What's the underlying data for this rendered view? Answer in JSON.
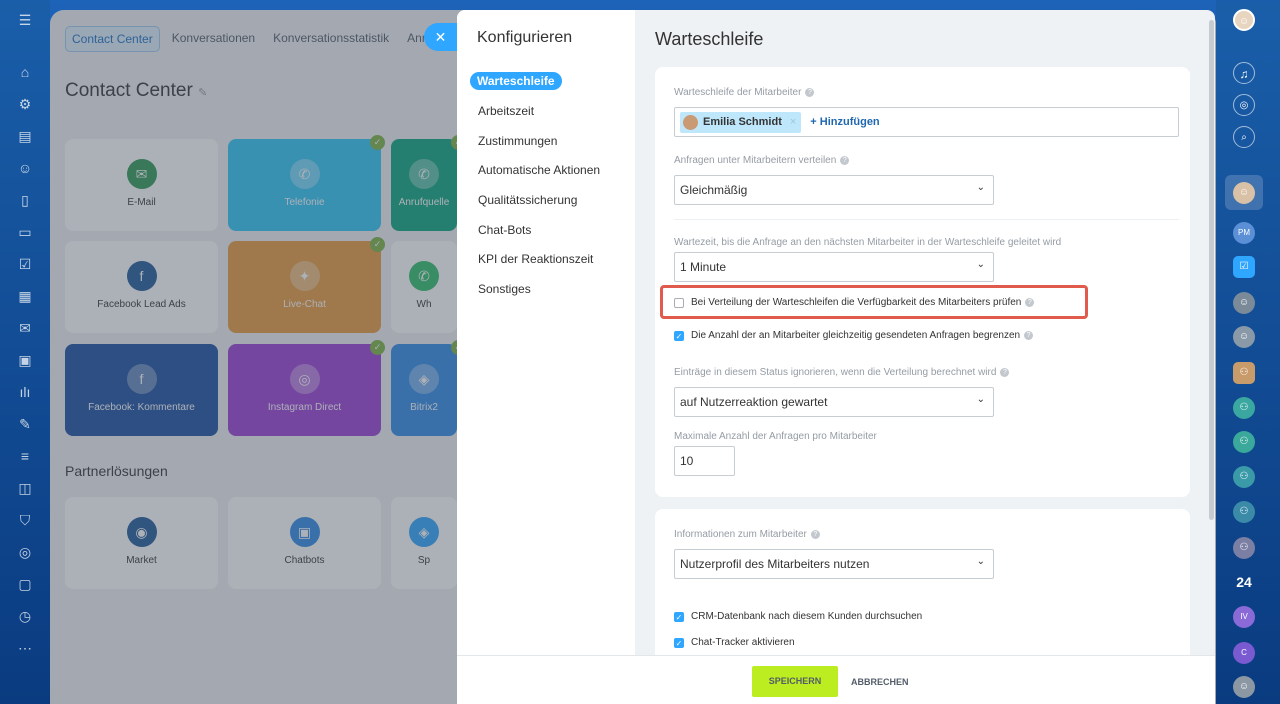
{
  "background": {
    "tabs": [
      "Contact Center",
      "Konversationen",
      "Konversationsstatistik",
      "Anrufu"
    ],
    "title": "Contact Center",
    "tiles": [
      {
        "label": "E-Mail",
        "icon": "mail-icon",
        "color": "#ffffff",
        "circle": "#2e9a55"
      },
      {
        "label": "Telefonie",
        "icon": "phone-icon",
        "color": "#2fc6f6",
        "circle": "#ffffff55"
      },
      {
        "label": "Anrufquelle",
        "icon": "phone-icon",
        "color": "#0aa67e",
        "circle": "#ffffff55"
      },
      {
        "label": "Facebook Lead Ads",
        "icon": "facebook-icon",
        "color": "#ffffff",
        "circle": "#1e5a9a"
      },
      {
        "label": "Live-Chat",
        "icon": "chat-icon",
        "color": "#e89b3c",
        "circle": "#ffffff55"
      },
      {
        "label": "Wh",
        "icon": "whatsapp-icon",
        "color": "#ffffff",
        "circle": "#2fc06a"
      },
      {
        "label": "Facebook: Kommentare",
        "icon": "facebook-comments-icon",
        "color": "#1a4fa0",
        "circle": "#ffffff55"
      },
      {
        "label": "Instagram Direct",
        "icon": "instagram-icon",
        "color": "#9b3ed6",
        "circle": "#ffffff55"
      },
      {
        "label": "Bitrix2",
        "icon": "bitrix-icon",
        "color": "#2f8ae6",
        "circle": "#ffffff55"
      }
    ],
    "partner_title": "Partnerlösungen",
    "partner_tiles": [
      "Market",
      "Chatbots",
      "Sp"
    ]
  },
  "nav": {
    "title": "Konfigurieren",
    "items": [
      "Warteschleife",
      "Arbeitszeit",
      "Zustimmungen",
      "Automatische Aktionen",
      "Qualitätssicherung",
      "Chat-Bots",
      "KPI der Reaktionszeit",
      "Sonstiges"
    ]
  },
  "content": {
    "title": "Warteschleife",
    "queue_label": "Warteschleife der Mitarbeiter",
    "queue_user": "Emilia Schmidt",
    "queue_add": "+ Hinzufügen",
    "distribute_label": "Anfragen unter Mitarbeitern verteilen",
    "distribute_value": "Gleichmäßig",
    "wait_label": "Wartezeit, bis die Anfrage an den nächsten Mitarbeiter in der Warteschleife geleitet wird",
    "wait_value": "1 Minute",
    "check_availability": {
      "label": "Bei Verteilung der Warteschleifen die Verfügbarkeit des Mitarbeiters prüfen",
      "checked": false
    },
    "check_limit": {
      "label": "Die Anzahl der an Mitarbeiter gleichzeitig gesendeten Anfragen begrenzen",
      "checked": true
    },
    "ignore_label": "Einträge in diesem Status ignorieren, wenn die Verteilung berechnet wird",
    "ignore_value": "auf Nutzerreaktion gewartet",
    "max_label": "Maximale Anzahl der Anfragen pro Mitarbeiter",
    "max_value": "10",
    "info_label": "Informationen zum Mitarbeiter",
    "info_value": "Nutzerprofil des Mitarbeiters nutzen",
    "check_crm": {
      "label": "CRM-Datenbank nach diesem Kunden durchsuchen",
      "checked": true
    },
    "check_tracker": {
      "label": "Chat-Tracker aktivieren",
      "checked": true
    }
  },
  "footer": {
    "save": "SPEICHERN",
    "cancel": "ABBRECHEN"
  },
  "right_rail": {
    "counter_label": "24",
    "initials_pm": "PM",
    "initials_iv": "IV",
    "initials_c": "C"
  },
  "colors": {
    "accent": "#2fa6ff",
    "save": "#bbed21",
    "highlight": "#e05b4c"
  }
}
